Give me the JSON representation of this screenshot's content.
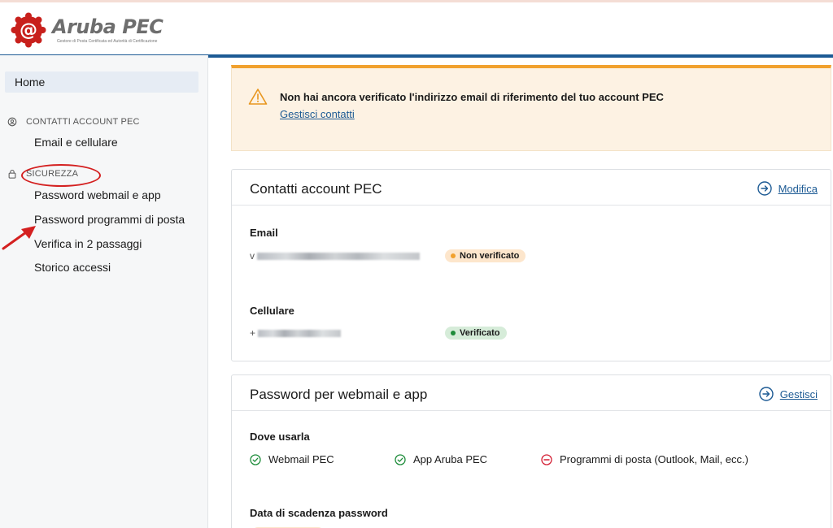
{
  "brand": {
    "name": "Aruba",
    "product": "PEC",
    "tagline": "Gestore di Posta Certificata ed Autorità di Certificazione"
  },
  "sidebar": {
    "home": "Home",
    "sections": [
      {
        "label": "CONTATTI ACCOUNT PEC",
        "icon": "user-circle-icon",
        "items": [
          "Email e cellulare"
        ]
      },
      {
        "label": "SICUREZZA",
        "icon": "lock-icon",
        "items": [
          "Password webmail e app",
          "Password programmi di posta",
          "Verifica in 2 passaggi",
          "Storico accessi"
        ]
      }
    ]
  },
  "alert": {
    "message": "Non hai ancora verificato l'indirizzo email di riferimento del tuo account PEC",
    "link": "Gestisci contatti",
    "icon": "warning-icon"
  },
  "contacts_card": {
    "title": "Contatti account PEC",
    "action": "Modifica",
    "email_label": "Email",
    "email_value_prefix": "v",
    "email_status": "Non verificato",
    "phone_label": "Cellulare",
    "phone_value_prefix": "+",
    "phone_status": "Verificato"
  },
  "password_card": {
    "title": "Password per webmail e app",
    "action": "Gestisci",
    "where_label": "Dove usarla",
    "usage": [
      {
        "label": "Webmail PEC",
        "allowed": true
      },
      {
        "label": "App Aruba PEC",
        "allowed": true
      },
      {
        "label": "Programmi di posta (Outlook, Mail, ecc.)",
        "allowed": false
      }
    ],
    "expiry_label": "Data di scadenza password"
  },
  "colors": {
    "brand_blue": "#1c5a94",
    "warning": "#f1a12e",
    "ok": "#1e8c3a",
    "danger": "#d42035",
    "annotation": "#d42020"
  }
}
